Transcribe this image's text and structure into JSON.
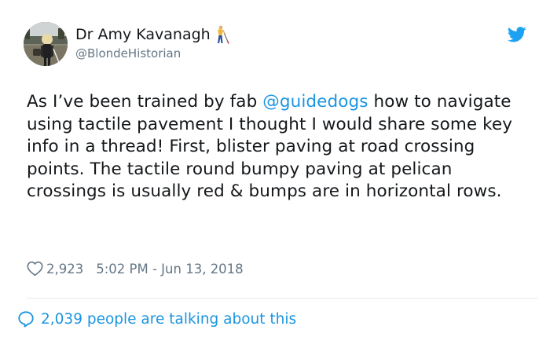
{
  "author": {
    "display_name": "Dr Amy Kavanagh",
    "name_emoji_icon": "person-with-white-cane-icon",
    "handle": "@BlondeHistorian",
    "avatar_icon": "profile-photo"
  },
  "brand": {
    "logo_icon": "twitter-bird-icon",
    "accent_color": "#1b95e0"
  },
  "tweet": {
    "text_before": "As I’ve been trained by fab ",
    "mention": "@guidedogs",
    "text_after": " how to navigate using tactile pavement I thought I would share some key info in a thread! First, blister paving at road crossing points. The tactile round bumpy paving at pelican crossings is usually red & bumps are in horizontal rows."
  },
  "meta": {
    "likes": "2,923",
    "timestamp": "5:02 PM - Jun 13, 2018"
  },
  "footer": {
    "talking_text": "2,039 people are talking about this"
  }
}
